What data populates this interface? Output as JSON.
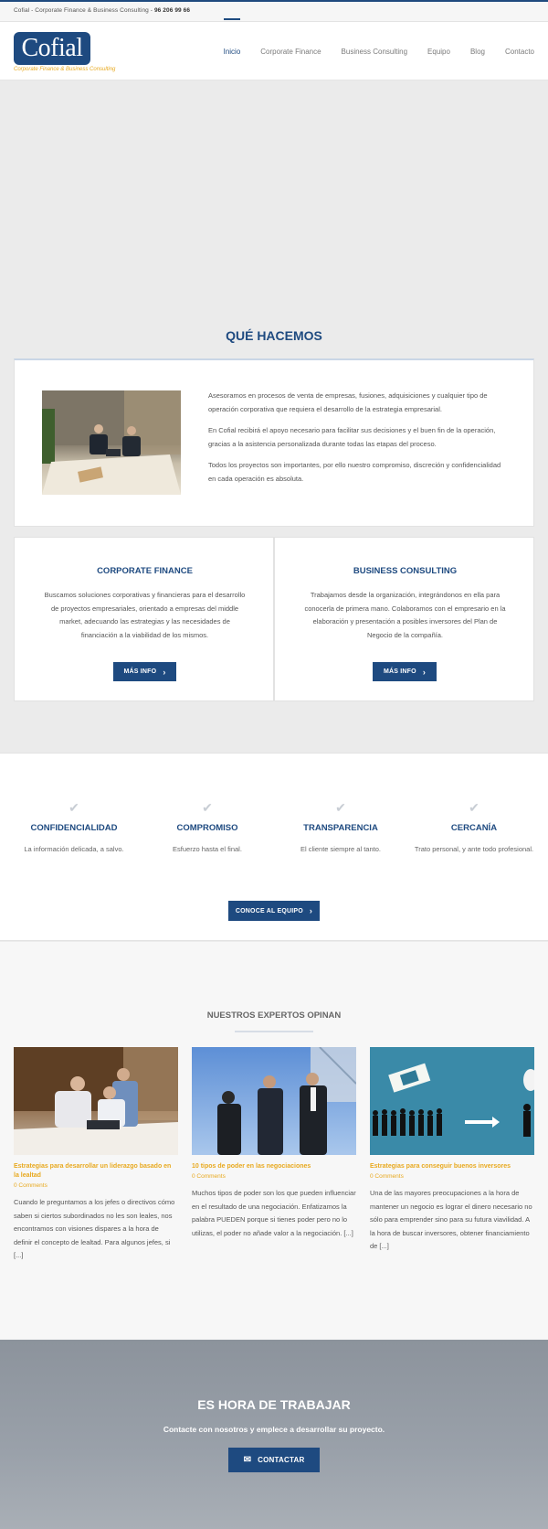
{
  "topbar": {
    "text": "Cofial - Corporate Finance & Business Consulting - ",
    "phone": "96 206 99 66"
  },
  "brand": {
    "logo": "Cofial",
    "tagline": "Corporate Finance & Business Consulting"
  },
  "nav": [
    "Inicio",
    "Corporate Finance",
    "Business Consulting",
    "Equipo",
    "Blog",
    "Contacto"
  ],
  "que_hacemos": {
    "title": "QUÉ HACEMOS",
    "paragraphs": [
      "Asesoramos en procesos de venta de empresas, fusiones, adquisiciones y cualquier tipo de operación corporativa que requiera el desarrollo de la estrategia empresarial.",
      "En Cofial recibirá el apoyo necesario para facilitar sus decisiones y el buen fin de la operación, gracias a la asistencia personalizada durante todas las etapas del proceso.",
      "Todos los proyectos son importantes, por ello nuestro compromiso, discreción y confidencialidad en cada operación es absoluta."
    ]
  },
  "services": [
    {
      "title": "CORPORATE FINANCE",
      "text": "Buscamos soluciones corporativas y financieras para el desarrollo de proyectos empresariales, orientado a empresas del middle market, adecuando las estrategias y las necesidades de financiación a la viabilidad de los mismos.",
      "button": "MÁS INFO"
    },
    {
      "title": "BUSINESS CONSULTING",
      "text": "Trabajamos desde la organización, integrándonos en ella para conocerla de primera mano. Colaboramos con el empresario en la elaboración y presentación a posibles inversores del Plan de Negocio de la compañía.",
      "button": "MÁS INFO"
    }
  ],
  "values": [
    {
      "title": "CONFIDENCIALIDAD",
      "text": "La información delicada, a salvo."
    },
    {
      "title": "COMPROMISO",
      "text": "Esfuerzo hasta el final."
    },
    {
      "title": "TRANSPARENCIA",
      "text": "El cliente siempre al tanto."
    },
    {
      "title": "CERCANÍA",
      "text": "Trato personal, y ante todo profesional."
    }
  ],
  "team_button": "CONOCE AL EQUIPO",
  "blog": {
    "title": "NUESTROS EXPERTOS OPINAN",
    "posts": [
      {
        "title": "Estrategias para desarrollar un liderazgo basado en la lealtad",
        "comments": "0 Comments",
        "excerpt": "Cuando le preguntamos a los jefes o directivos cómo saben si ciertos subordinados no les son leales, nos encontramos con visiones dispares a la hora de definir el concepto de lealtad. Para algunos jefes, si [...]"
      },
      {
        "title": "10 tipos de poder en las negociaciones",
        "comments": "0 Comments",
        "excerpt": "Muchos tipos de poder son los que pueden influenciar en el resultado de una negociación. Enfatizamos la palabra PUEDEN porque si tienes poder pero no lo utilizas, el poder no añade valor a la negociación. [...]"
      },
      {
        "title": "Estrategias para conseguir buenos inversores",
        "comments": "0 Comments",
        "excerpt": "Una de las mayores preocupaciones a la hora de mantener un negocio es lograr el dinero necesario no sólo para emprender sino para su futura viavilidad. A la hora de buscar inversores, obtener financiamiento de [...]"
      }
    ]
  },
  "cta": {
    "title": "ES HORA DE TRABAJAR",
    "subtitle": "Contacte con nosotros y emplece a desarrollar su proyecto.",
    "button": "CONTACTAR"
  },
  "colors": {
    "primary": "#1e4a80",
    "accent": "#e8a91f",
    "background": "#ebebeb"
  }
}
